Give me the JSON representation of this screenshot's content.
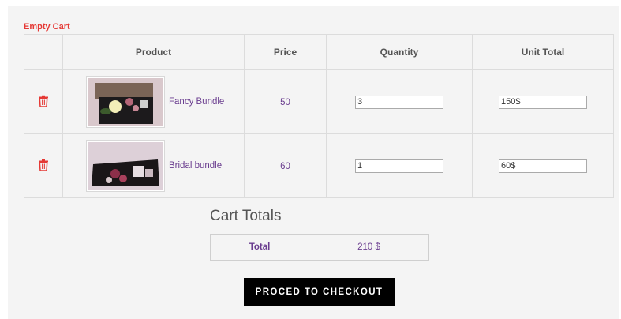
{
  "cart": {
    "empty_cart_label": "Empty Cart",
    "columns": [
      "Product",
      "Price",
      "Quantity",
      "Unit Total"
    ],
    "items": [
      {
        "name": "Fancy Bundle",
        "price": "50",
        "quantity": "3",
        "unit_total": "150$"
      },
      {
        "name": "Bridal bundle",
        "price": "60",
        "quantity": "1",
        "unit_total": "60$"
      }
    ]
  },
  "totals": {
    "title": "Cart Totals",
    "label": "Total",
    "value": "210  $"
  },
  "checkout": {
    "label": "PROCED TO CHECKOUT"
  },
  "colors": {
    "accent_red": "#e53935",
    "link_purple": "#6a3d8f",
    "button_black": "#000000"
  }
}
